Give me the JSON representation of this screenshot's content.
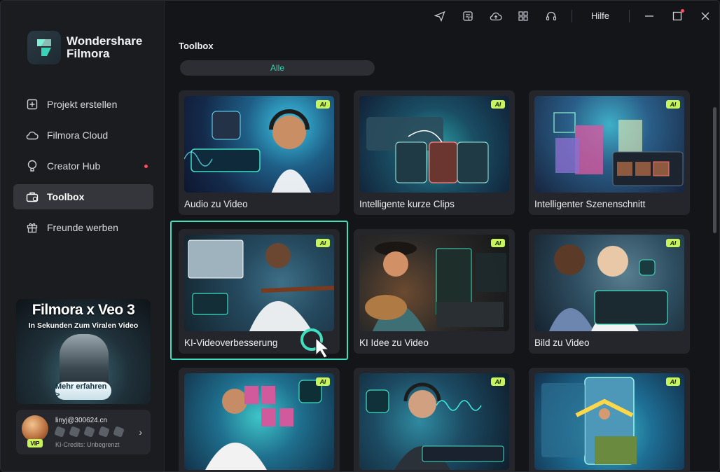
{
  "app": {
    "name_line1": "Wondershare",
    "name_line2": "Filmora"
  },
  "sidebar": {
    "items": [
      {
        "label": "Projekt erstellen",
        "icon": "plus-square-icon",
        "active": false,
        "dot": false
      },
      {
        "label": "Filmora Cloud",
        "icon": "cloud-icon",
        "active": false,
        "dot": false
      },
      {
        "label": "Creator Hub",
        "icon": "bulb-icon",
        "active": false,
        "dot": true
      },
      {
        "label": "Toolbox",
        "icon": "toolbox-icon",
        "active": true,
        "dot": false
      },
      {
        "label": "Freunde werben",
        "icon": "gift-icon",
        "active": false,
        "dot": false
      }
    ],
    "promo": {
      "title": "Filmora x Veo 3",
      "subtitle": "In Sekunden Zum Viralen Video",
      "button": "Mehr erfahren >"
    },
    "account": {
      "email": "linyj@300624.cn",
      "vip": "VIP",
      "credits": "KI-Credits: Unbegrenzt"
    }
  },
  "titlebar": {
    "help": "Hilfe",
    "icons": [
      "send-icon",
      "task-list-icon",
      "cloud-upload-icon",
      "grid-apps-icon",
      "headset-icon"
    ]
  },
  "main": {
    "section_title": "Toolbox",
    "filter_label": "Alle",
    "cards": [
      {
        "label": "Audio zu Video",
        "ai": "AI"
      },
      {
        "label": "Intelligente kurze Clips",
        "ai": "AI"
      },
      {
        "label": "Intelligenter Szenenschnitt",
        "ai": "AI"
      },
      {
        "label": "KI-Videoverbesserung",
        "ai": "AI"
      },
      {
        "label": "KI Idee zu Video",
        "ai": "AI"
      },
      {
        "label": "Bild zu Video",
        "ai": "AI"
      },
      {
        "label": "",
        "ai": "AI"
      },
      {
        "label": "",
        "ai": "AI"
      },
      {
        "label": "",
        "ai": "AI"
      }
    ]
  },
  "colors": {
    "accent": "#3fe0c0",
    "ai_badge": "#c6f45a",
    "notification": "#ff4d5e"
  }
}
